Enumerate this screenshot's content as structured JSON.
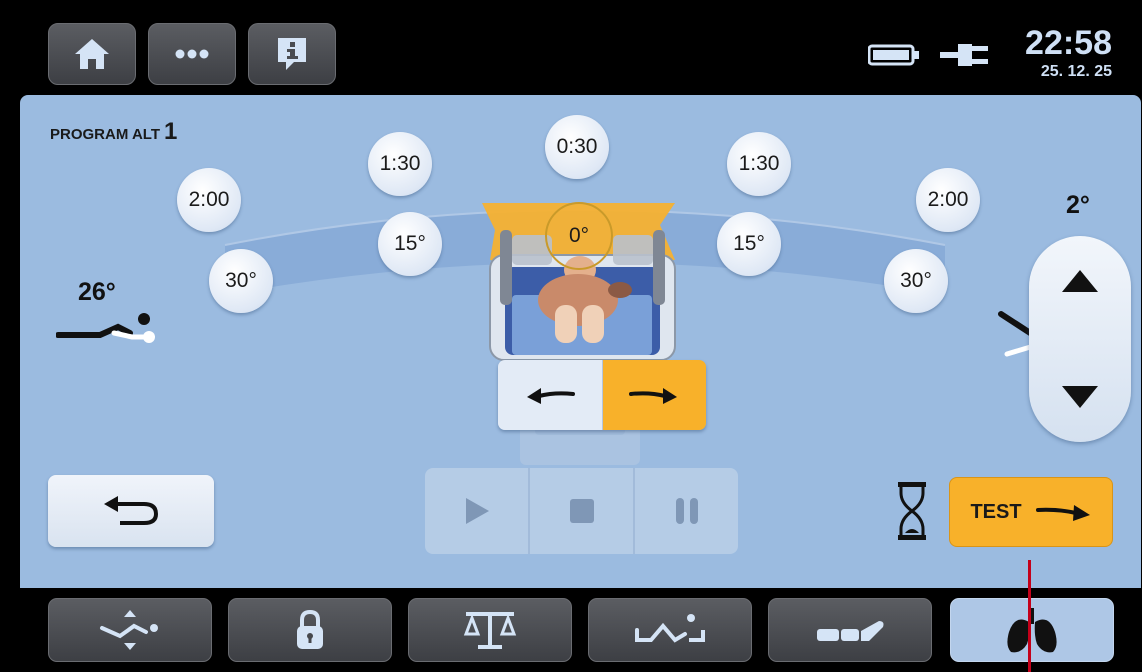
{
  "topbar": {
    "buttons": [
      {
        "icon": "home-icon"
      },
      {
        "icon": "more-icon"
      },
      {
        "icon": "info-icon"
      }
    ],
    "time": "22:58",
    "date": "25. 12. 25",
    "status_icons": [
      "battery-icon",
      "plug-icon"
    ]
  },
  "program": {
    "label": "PROGRAM ALT",
    "number": "1"
  },
  "timers": {
    "center": "0:30",
    "left_mid": "1:30",
    "right_mid": "1:30",
    "left_outer": "2:00",
    "right_outer": "2:00"
  },
  "angles": {
    "center": "0°",
    "left_mid": "15°",
    "right_mid": "15°",
    "left_outer": "30°",
    "right_outer": "30°"
  },
  "left_tilt": "26°",
  "right_tilt": "2°",
  "test_button": "TEST",
  "colors": {
    "accent": "#f8b12a",
    "panel": "#9bbbe0",
    "active_tab": "#aec7e6"
  },
  "bottom_tabs": [
    {
      "icon": "position-icon"
    },
    {
      "icon": "lock-icon"
    },
    {
      "icon": "scale-icon"
    },
    {
      "icon": "bed-exercise-icon"
    },
    {
      "icon": "mattress-icon"
    },
    {
      "icon": "lungs-icon",
      "active": true
    }
  ]
}
